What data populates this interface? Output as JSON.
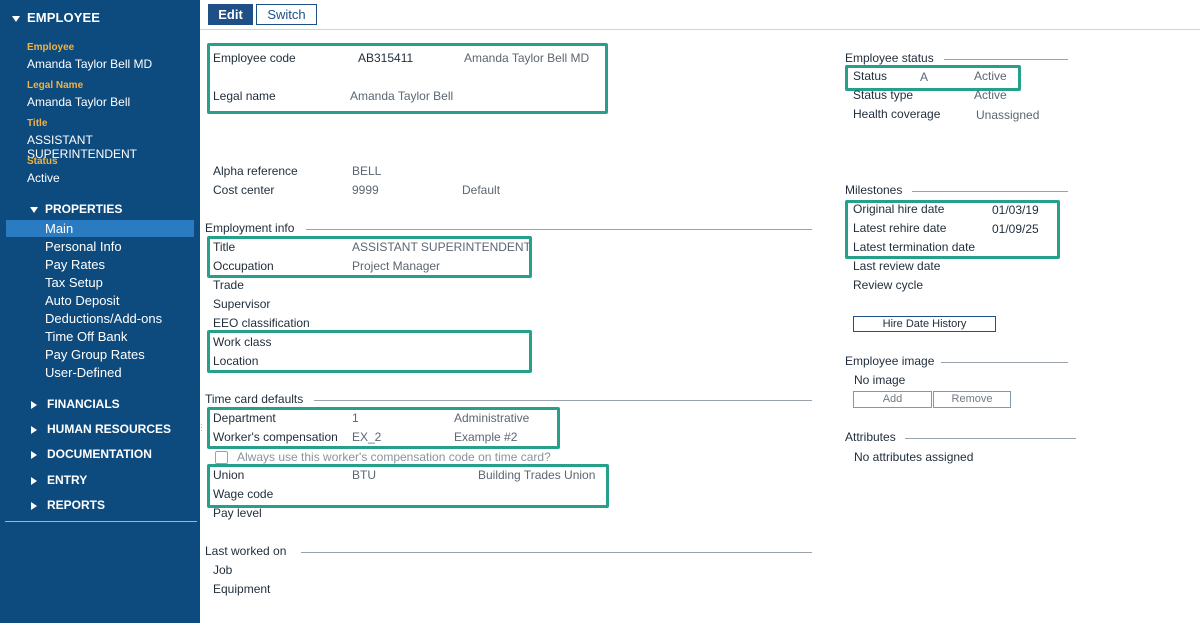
{
  "sidebar": {
    "header": "EMPLOYEE",
    "info": [
      {
        "label": "Employee",
        "value": "Amanda Taylor Bell MD"
      },
      {
        "label": "Legal Name",
        "value": "Amanda Taylor Bell"
      },
      {
        "label": "Title",
        "value": "ASSISTANT SUPERINTENDENT"
      },
      {
        "label": "Status",
        "value": "Active"
      }
    ],
    "properties_label": "PROPERTIES",
    "nav": [
      "Main",
      "Personal Info",
      "Pay Rates",
      "Tax Setup",
      "Auto Deposit",
      "Deductions/Add-ons",
      "Time Off Bank",
      "Pay Group Rates",
      "User-Defined"
    ],
    "sections": [
      "FINANCIALS",
      "HUMAN RESOURCES",
      "DOCUMENTATION",
      "ENTRY",
      "REPORTS"
    ]
  },
  "toolbar": {
    "edit": "Edit",
    "switch": "Switch"
  },
  "identity": {
    "employee_code_label": "Employee code",
    "employee_code": "AB315411",
    "employee_name": "Amanda Taylor Bell MD",
    "legal_name_label": "Legal name",
    "legal_name": "Amanda Taylor Bell"
  },
  "refs": {
    "alpha_label": "Alpha reference",
    "alpha": "BELL",
    "cost_label": "Cost center",
    "cost": "9999",
    "cost_desc": "Default"
  },
  "employment": {
    "title": "Employment info",
    "title_label": "Title",
    "title_value": "ASSISTANT SUPERINTENDENT",
    "occupation_label": "Occupation",
    "occupation": "Project Manager",
    "trade_label": "Trade",
    "supervisor_label": "Supervisor",
    "eeo_label": "EEO classification",
    "work_class_label": "Work class",
    "location_label": "Location"
  },
  "timecard": {
    "title": "Time card defaults",
    "department_label": "Department",
    "department_code": "1",
    "department_name": "Administrative",
    "wc_label": "Worker's compensation",
    "wc_code": "EX_2",
    "wc_name": "Example #2",
    "checkbox_label": "Always use this worker's compensation code on time card?",
    "union_label": "Union",
    "union_code": "BTU",
    "union_name": "Building Trades Union",
    "wage_label": "Wage code",
    "pay_level_label": "Pay level"
  },
  "last_worked": {
    "title": "Last worked on",
    "job_label": "Job",
    "equipment_label": "Equipment"
  },
  "status": {
    "title": "Employee status",
    "status_label": "Status",
    "status_code": "A",
    "status_value": "Active",
    "type_label": "Status type",
    "type_value": "Active",
    "health_label": "Health coverage",
    "health_value": "Unassigned"
  },
  "milestones": {
    "title": "Milestones",
    "hire_label": "Original hire date",
    "hire": "01/03/19",
    "rehire_label": "Latest rehire date",
    "rehire": "01/09/25",
    "term_label": "Latest termination date",
    "review_label": "Last review date",
    "cycle_label": "Review cycle",
    "history_button": "Hire Date History"
  },
  "image": {
    "title": "Employee image",
    "none": "No image",
    "add": "Add",
    "remove": "Remove"
  },
  "attributes": {
    "title": "Attributes",
    "none": "No attributes assigned"
  },
  "colors": {
    "sidebar": "#0d4a7e",
    "active_nav": "#2a7bc2",
    "highlight": "#26a08a",
    "sidebar_label": "#f4b23e"
  }
}
